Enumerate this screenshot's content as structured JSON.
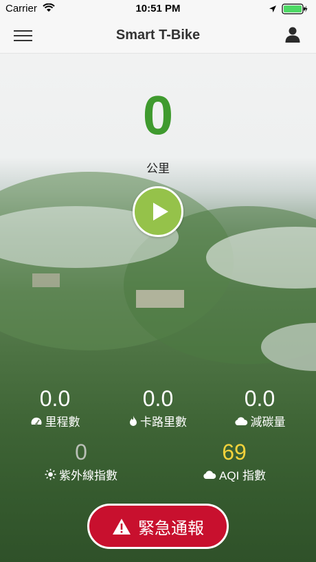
{
  "status_bar": {
    "carrier": "Carrier",
    "time": "10:51 PM"
  },
  "nav": {
    "title": "Smart T-Bike"
  },
  "ride": {
    "distance": "0",
    "unit": "公里"
  },
  "stats": [
    {
      "value": "0.0",
      "label": "里程數",
      "icon": "speedometer-icon"
    },
    {
      "value": "0.0",
      "label": "卡路里數",
      "icon": "flame-icon"
    },
    {
      "value": "0.0",
      "label": "減碳量",
      "icon": "cloud-icon"
    }
  ],
  "env": {
    "uv": {
      "value": "0",
      "label": "紫外線指數",
      "icon": "sun-icon"
    },
    "aqi": {
      "value": "69",
      "label": "AQI 指數",
      "icon": "cloud-icon"
    }
  },
  "emergency": {
    "label": "緊急通報"
  },
  "colors": {
    "accent_green": "#3f9a2e",
    "play_green": "#95c24a",
    "aqi_yellow": "#f3d23b",
    "emergency_red": "#c8102e"
  }
}
